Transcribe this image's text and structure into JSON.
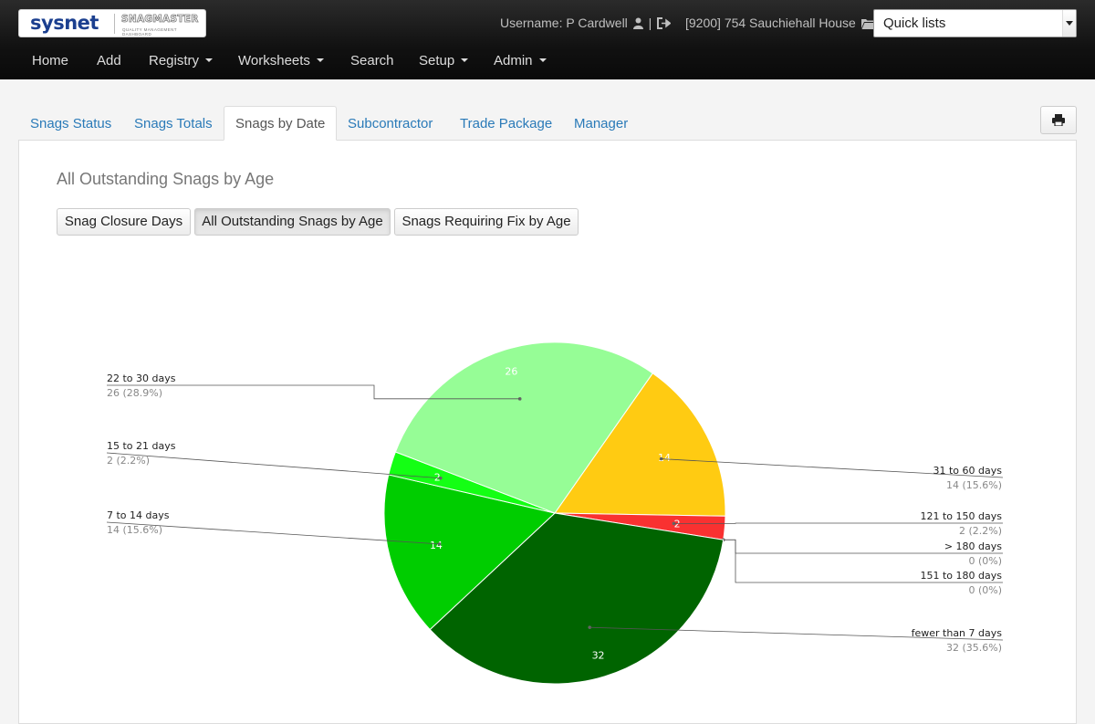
{
  "header": {
    "logo": {
      "brand": "sysnet",
      "product": "SNAGMASTER",
      "tagline": "QUALITY MANAGEMENT DASHBOARD"
    },
    "username": "Username: P Cardwell",
    "separator": "|",
    "project": "[9200] 754 Sauchiehall House",
    "quick_lists": "Quick lists",
    "icons": {
      "user": "user-icon",
      "logout": "sign-out-icon",
      "project": "folder-open-icon",
      "dropdown": "chevron-down-icon"
    }
  },
  "nav": [
    {
      "label": "Home",
      "dropdown": false
    },
    {
      "label": "Add",
      "dropdown": false
    },
    {
      "label": "Registry",
      "dropdown": true
    },
    {
      "label": "Worksheets",
      "dropdown": true
    },
    {
      "label": "Search",
      "dropdown": false
    },
    {
      "label": "Setup",
      "dropdown": true
    },
    {
      "label": "Admin",
      "dropdown": true
    }
  ],
  "tabs": [
    {
      "label": "Snags Status",
      "active": false
    },
    {
      "label": "Snags Totals",
      "active": false
    },
    {
      "label": "Snags by Date",
      "active": true
    },
    {
      "label": "Subcontractor",
      "active": false
    },
    {
      "label": "Trade Package",
      "active": false
    },
    {
      "label": "Manager",
      "active": false
    }
  ],
  "print_icon": "print-icon",
  "panel": {
    "title": "All Outstanding Snags by Age",
    "buttons": [
      {
        "label": "Snag Closure Days",
        "active": false
      },
      {
        "label": "All Outstanding Snags by Age",
        "active": true
      },
      {
        "label": "Snags Requiring Fix by Age",
        "active": false
      }
    ]
  },
  "colors": {
    "nav_bg": "#111111",
    "link": "#2a7ab8",
    "slice_26": "#96fd96",
    "slice_14_yellow": "#ffcb12",
    "slice_2_red": "#f93131",
    "slice_32": "#006400",
    "slice_14_green": "#00cd00",
    "slice_2_green": "#14ff14"
  },
  "chart_data": {
    "type": "pie",
    "title": "",
    "total": 90,
    "slices": [
      {
        "name": "31 to 60 days",
        "value": 14,
        "label": "14 (15.6%)",
        "color": "#ffcb12",
        "inner": "14"
      },
      {
        "name": "121 to 150 days",
        "value": 2,
        "label": "2 (2.2%)",
        "color": "#f93131",
        "inner": "2"
      },
      {
        "name": "> 180 days",
        "value": 0,
        "label": "0 (0%)",
        "color": "#f93131",
        "inner": ""
      },
      {
        "name": "151 to 180 days",
        "value": 0,
        "label": "0 (0%)",
        "color": "#f93131",
        "inner": ""
      },
      {
        "name": "fewer than 7 days",
        "value": 32,
        "label": "32 (35.6%)",
        "color": "#006400",
        "inner": "32"
      },
      {
        "name": "7 to 14 days",
        "value": 14,
        "label": "14 (15.6%)",
        "color": "#00cd00",
        "inner": "14"
      },
      {
        "name": "15 to 21 days",
        "value": 2,
        "label": "2 (2.2%)",
        "color": "#14ff14",
        "inner": "2"
      },
      {
        "name": "22 to 30 days",
        "value": 26,
        "label": "26 (28.9%)",
        "color": "#96fd96",
        "inner": "26"
      }
    ]
  }
}
